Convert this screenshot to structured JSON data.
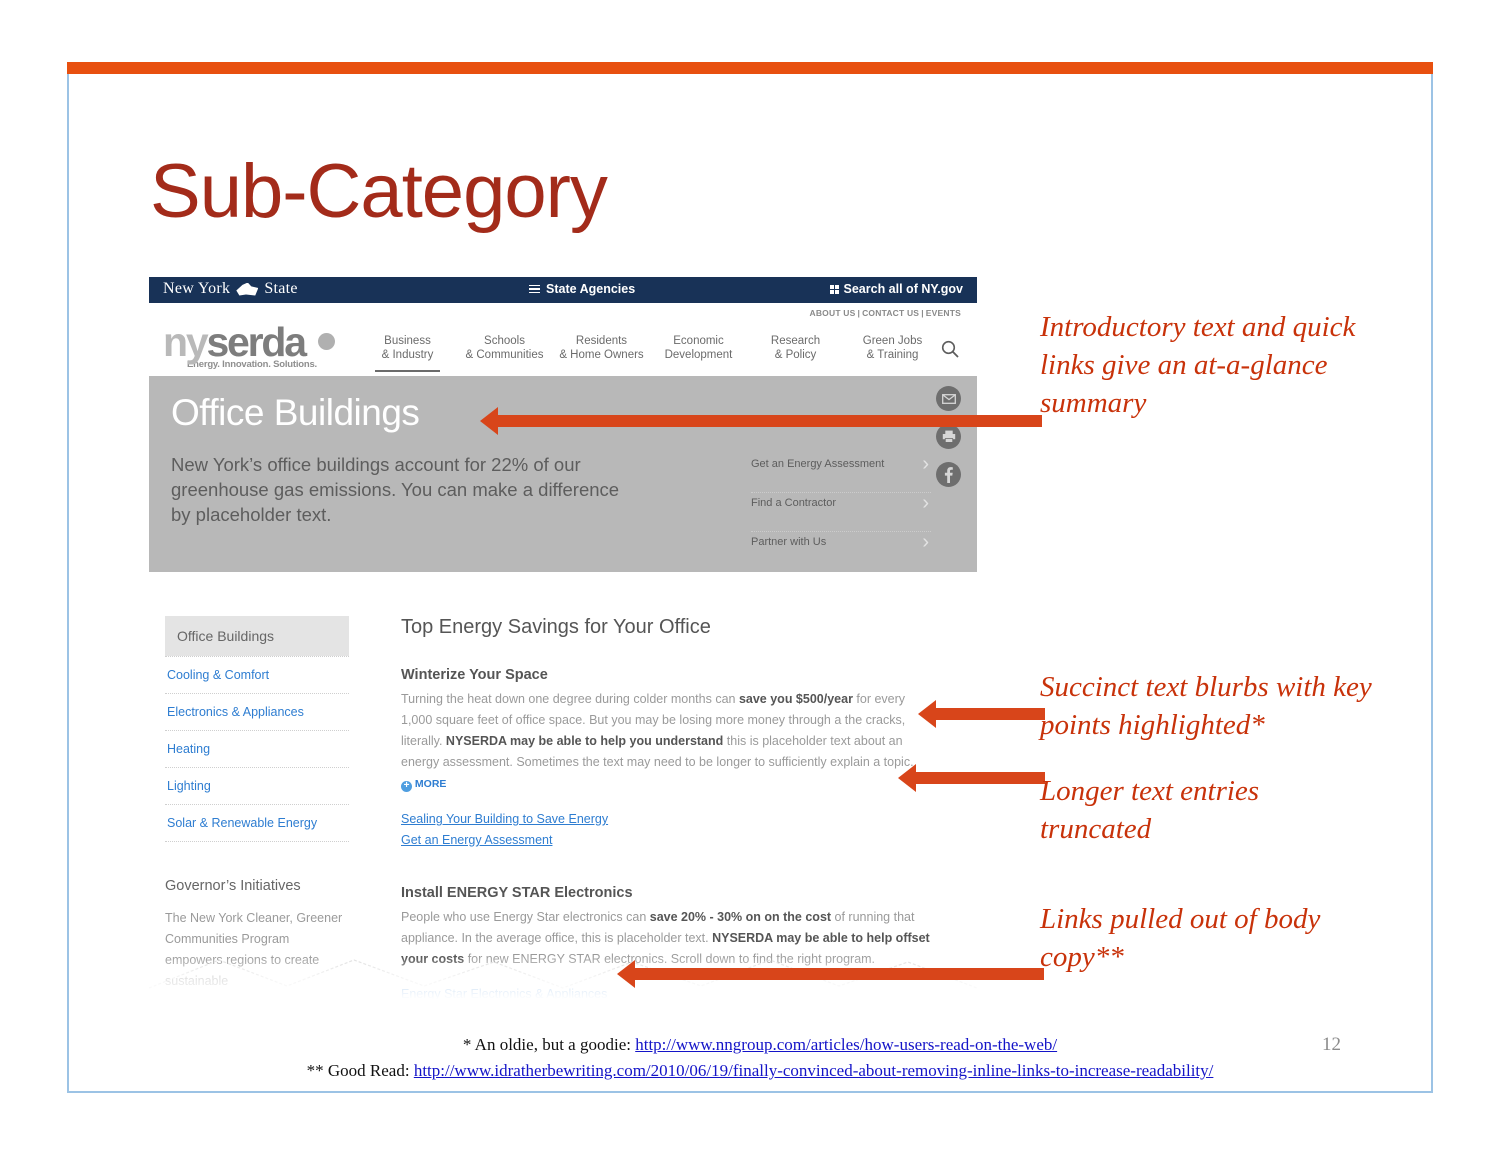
{
  "slide": {
    "title": "Sub-Category",
    "page_number": "12",
    "accent_color": "#E8500F",
    "border_color": "#9CC3E5",
    "title_color": "#A32B1A",
    "annotation_color": "#C8320A"
  },
  "site": {
    "nygov_bar": {
      "brand_left": "New York",
      "brand_right": "State",
      "agencies_label": "State Agencies",
      "search_label": "Search all of NY.gov"
    },
    "utility_nav": [
      "ABOUT US",
      "CONTACT US",
      "EVENTS"
    ],
    "logo": {
      "prefix": "ny",
      "word": "serda",
      "tagline": "Energy. Innovation. Solutions."
    },
    "main_nav": [
      {
        "line1": "Business",
        "line2": "& Industry",
        "active": true
      },
      {
        "line1": "Schools",
        "line2": "& Communities",
        "active": false
      },
      {
        "line1": "Residents",
        "line2": "& Home Owners",
        "active": false
      },
      {
        "line1": "Economic",
        "line2": "Development",
        "active": false
      },
      {
        "line1": "Research",
        "line2": "& Policy",
        "active": false
      },
      {
        "line1": "Green Jobs",
        "line2": "& Training",
        "active": false
      }
    ],
    "hero": {
      "title": "Office Buildings",
      "subtitle": "New York’s office buildings account for 22% of our greenhouse gas emissions. You can make a difference by placeholder text.",
      "quick_links": [
        "Get an Energy Assessment",
        "Find a Contractor",
        "Partner with Us"
      ],
      "social_icons": [
        "email-icon",
        "print-icon",
        "facebook-icon"
      ],
      "background_color": "#b8b8b8"
    },
    "sidebar": {
      "current": "Office Buildings",
      "links": [
        "Cooling & Comfort",
        "Electronics & Appliances",
        "Heating",
        "Lighting",
        "Solar & Renewable Energy"
      ],
      "governor": {
        "heading": "Governor’s Initiatives",
        "body": "The New York Cleaner, Greener Communities Program empowers regions to create sustainable"
      }
    },
    "main": {
      "heading": "Top Energy Savings for Your Office",
      "sections": [
        {
          "heading": "Winterize Your Space",
          "para_parts": [
            {
              "text": "Turning the heat down one degree during colder months can ",
              "bold": false
            },
            {
              "text": "save you $500/year",
              "bold": true
            },
            {
              "text": " for every 1,000 square feet of office space. But you may be losing more money through a the cracks, literally. ",
              "bold": false
            },
            {
              "text": "NYSERDA may be able to help you understand",
              "bold": true
            },
            {
              "text": " this is placeholder text about an energy assessment. Sometimes the text may need to be longer to sufficiently explain a topic. ",
              "bold": false
            }
          ],
          "more_label": "MORE",
          "links": [
            "Sealing Your Building to Save Energy",
            "Get an Energy Assessment"
          ]
        },
        {
          "heading": "Install ENERGY STAR Electronics",
          "para_parts": [
            {
              "text": "People who use Energy Star electronics can ",
              "bold": false
            },
            {
              "text": "save 20% - 30% on on the cost",
              "bold": true
            },
            {
              "text": " of running that appliance. In the average office, this is placeholder text. ",
              "bold": false
            },
            {
              "text": "NYSERDA may be able to help offset your costs",
              "bold": true
            },
            {
              "text": " for new ENERGY STAR electronics. Scroll down to find the right program.",
              "bold": false
            }
          ],
          "more_label": "",
          "links": [
            "Energy Star Electronics & Appliances"
          ]
        }
      ],
      "link_color": "#2E7DD1"
    }
  },
  "annotations": [
    {
      "text": "Introductory text and quick links give an at-a-glance summary"
    },
    {
      "text": "Succinct text blurbs with key points highlighted*"
    },
    {
      "text": "Longer text entries truncated"
    },
    {
      "text": "Links pulled out of body copy**"
    }
  ],
  "footnotes": {
    "line1_prefix": "* An oldie, but a goodie: ",
    "line1_link": "http://www.nngroup.com/articles/how-users-read-on-the-web/",
    "line2_prefix": "** Good Read: ",
    "line2_link": "http://www.idratherbewriting.com/2010/06/19/finally-convinced-about-removing-inline-links-to-increase-readability/"
  }
}
